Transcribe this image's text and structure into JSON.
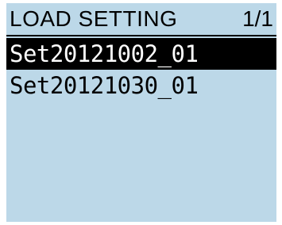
{
  "header": {
    "title": "LOAD SETTING",
    "page_indicator": "1/1"
  },
  "list": {
    "items": [
      {
        "label": "Set20121002_01",
        "selected": true
      },
      {
        "label": "Set20121030_01",
        "selected": false
      }
    ]
  },
  "colors": {
    "screen_background": "#bcd8e8",
    "selection_background": "#000000",
    "selection_text": "#ffffff",
    "text": "#000000"
  }
}
